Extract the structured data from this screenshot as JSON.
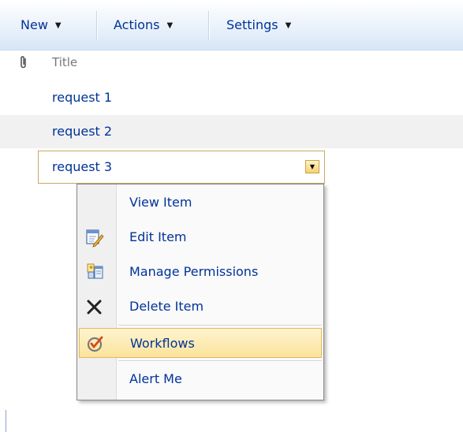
{
  "toolbar": {
    "new_label": "New",
    "actions_label": "Actions",
    "settings_label": "Settings"
  },
  "list": {
    "header_title": "Title",
    "rows": [
      {
        "title": "request 1"
      },
      {
        "title": "request 2"
      },
      {
        "title": "request 3"
      }
    ]
  },
  "context_menu": {
    "items": [
      {
        "label": "View Item",
        "icon": "none"
      },
      {
        "label": "Edit Item",
        "icon": "edit-icon"
      },
      {
        "label": "Manage Permissions",
        "icon": "permissions-icon"
      },
      {
        "label": "Delete Item",
        "icon": "delete-icon"
      },
      {
        "label": "Workflows",
        "icon": "workflow-icon",
        "highlighted": true
      },
      {
        "label": "Alert Me",
        "icon": "none"
      }
    ]
  },
  "colors": {
    "link": "#003399",
    "highlight": "#fbe39b",
    "selection_border": "#c7a765"
  }
}
